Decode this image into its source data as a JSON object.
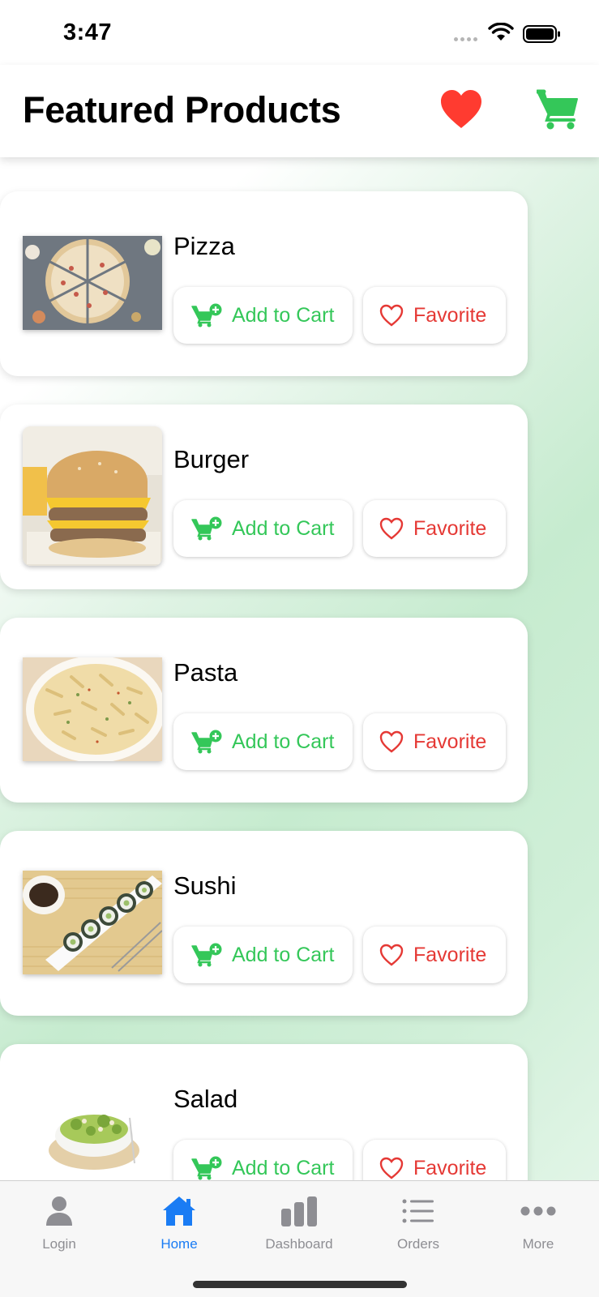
{
  "status": {
    "time": "3:47"
  },
  "header": {
    "title": "Featured Products",
    "favorites_icon": "heart-icon",
    "cart_icon": "cart-icon"
  },
  "colors": {
    "accent_green": "#34c759",
    "favorite_red": "#e53935",
    "active_tab": "#1a7cf4"
  },
  "products": [
    {
      "name": "Pizza",
      "add_label": "Add to Cart",
      "fav_label": "Favorite"
    },
    {
      "name": "Burger",
      "add_label": "Add to Cart",
      "fav_label": "Favorite"
    },
    {
      "name": "Pasta",
      "add_label": "Add to Cart",
      "fav_label": "Favorite"
    },
    {
      "name": "Sushi",
      "add_label": "Add to Cart",
      "fav_label": "Favorite"
    },
    {
      "name": "Salad",
      "add_label": "Add to Cart",
      "fav_label": "Favorite"
    }
  ],
  "tabs": [
    {
      "label": "Login",
      "icon": "person-icon",
      "active": false
    },
    {
      "label": "Home",
      "icon": "house-icon",
      "active": true
    },
    {
      "label": "Dashboard",
      "icon": "bar-chart-icon",
      "active": false
    },
    {
      "label": "Orders",
      "icon": "list-icon",
      "active": false
    },
    {
      "label": "More",
      "icon": "ellipsis-icon",
      "active": false
    }
  ]
}
